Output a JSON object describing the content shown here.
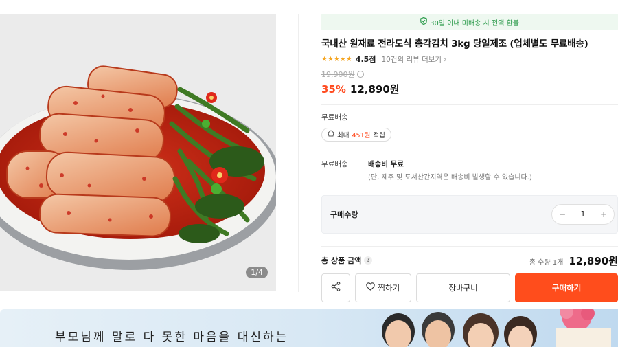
{
  "gallery": {
    "counter": "1/4"
  },
  "banner": {
    "text": "30일 이내 미배송 시 전액 환불"
  },
  "product": {
    "title": "국내산 원재료 전라도식 총각김치 3kg 당일제조 (업체별도 무료배송)",
    "rating_stars": "★★★★★",
    "rating_score": "4.5점",
    "review_link": "10건의 리뷰 더보기 ›",
    "original_price": "19,900원",
    "discount_rate": "35%",
    "sale_price": "12,890원"
  },
  "shipping": {
    "label": "무료배송",
    "point_prefix": "최대",
    "point_amount": "451원",
    "point_suffix": "적립",
    "fee_label": "무료배송",
    "fee_value": "배송비 무료",
    "fee_note": "(단, 제주 및 도서산간지역은 배송비 발생할 수 있습니다.)"
  },
  "quantity": {
    "label": "구매수량",
    "minus": "−",
    "value": "1",
    "plus": "+"
  },
  "total": {
    "label": "총 상품 금액",
    "help": "?",
    "qty_text": "총 수량 1개",
    "price": "12,890원"
  },
  "buttons": {
    "wish_label": "찜하기",
    "cart_label": "장바구니",
    "buy_label": "구매하기"
  },
  "promo": {
    "text": "부모님께 말로 다 못한 마음을 대신하는"
  },
  "colors": {
    "accent": "#ff4d1c",
    "banner_green": "#2a9a4a",
    "star": "#f5a623"
  }
}
